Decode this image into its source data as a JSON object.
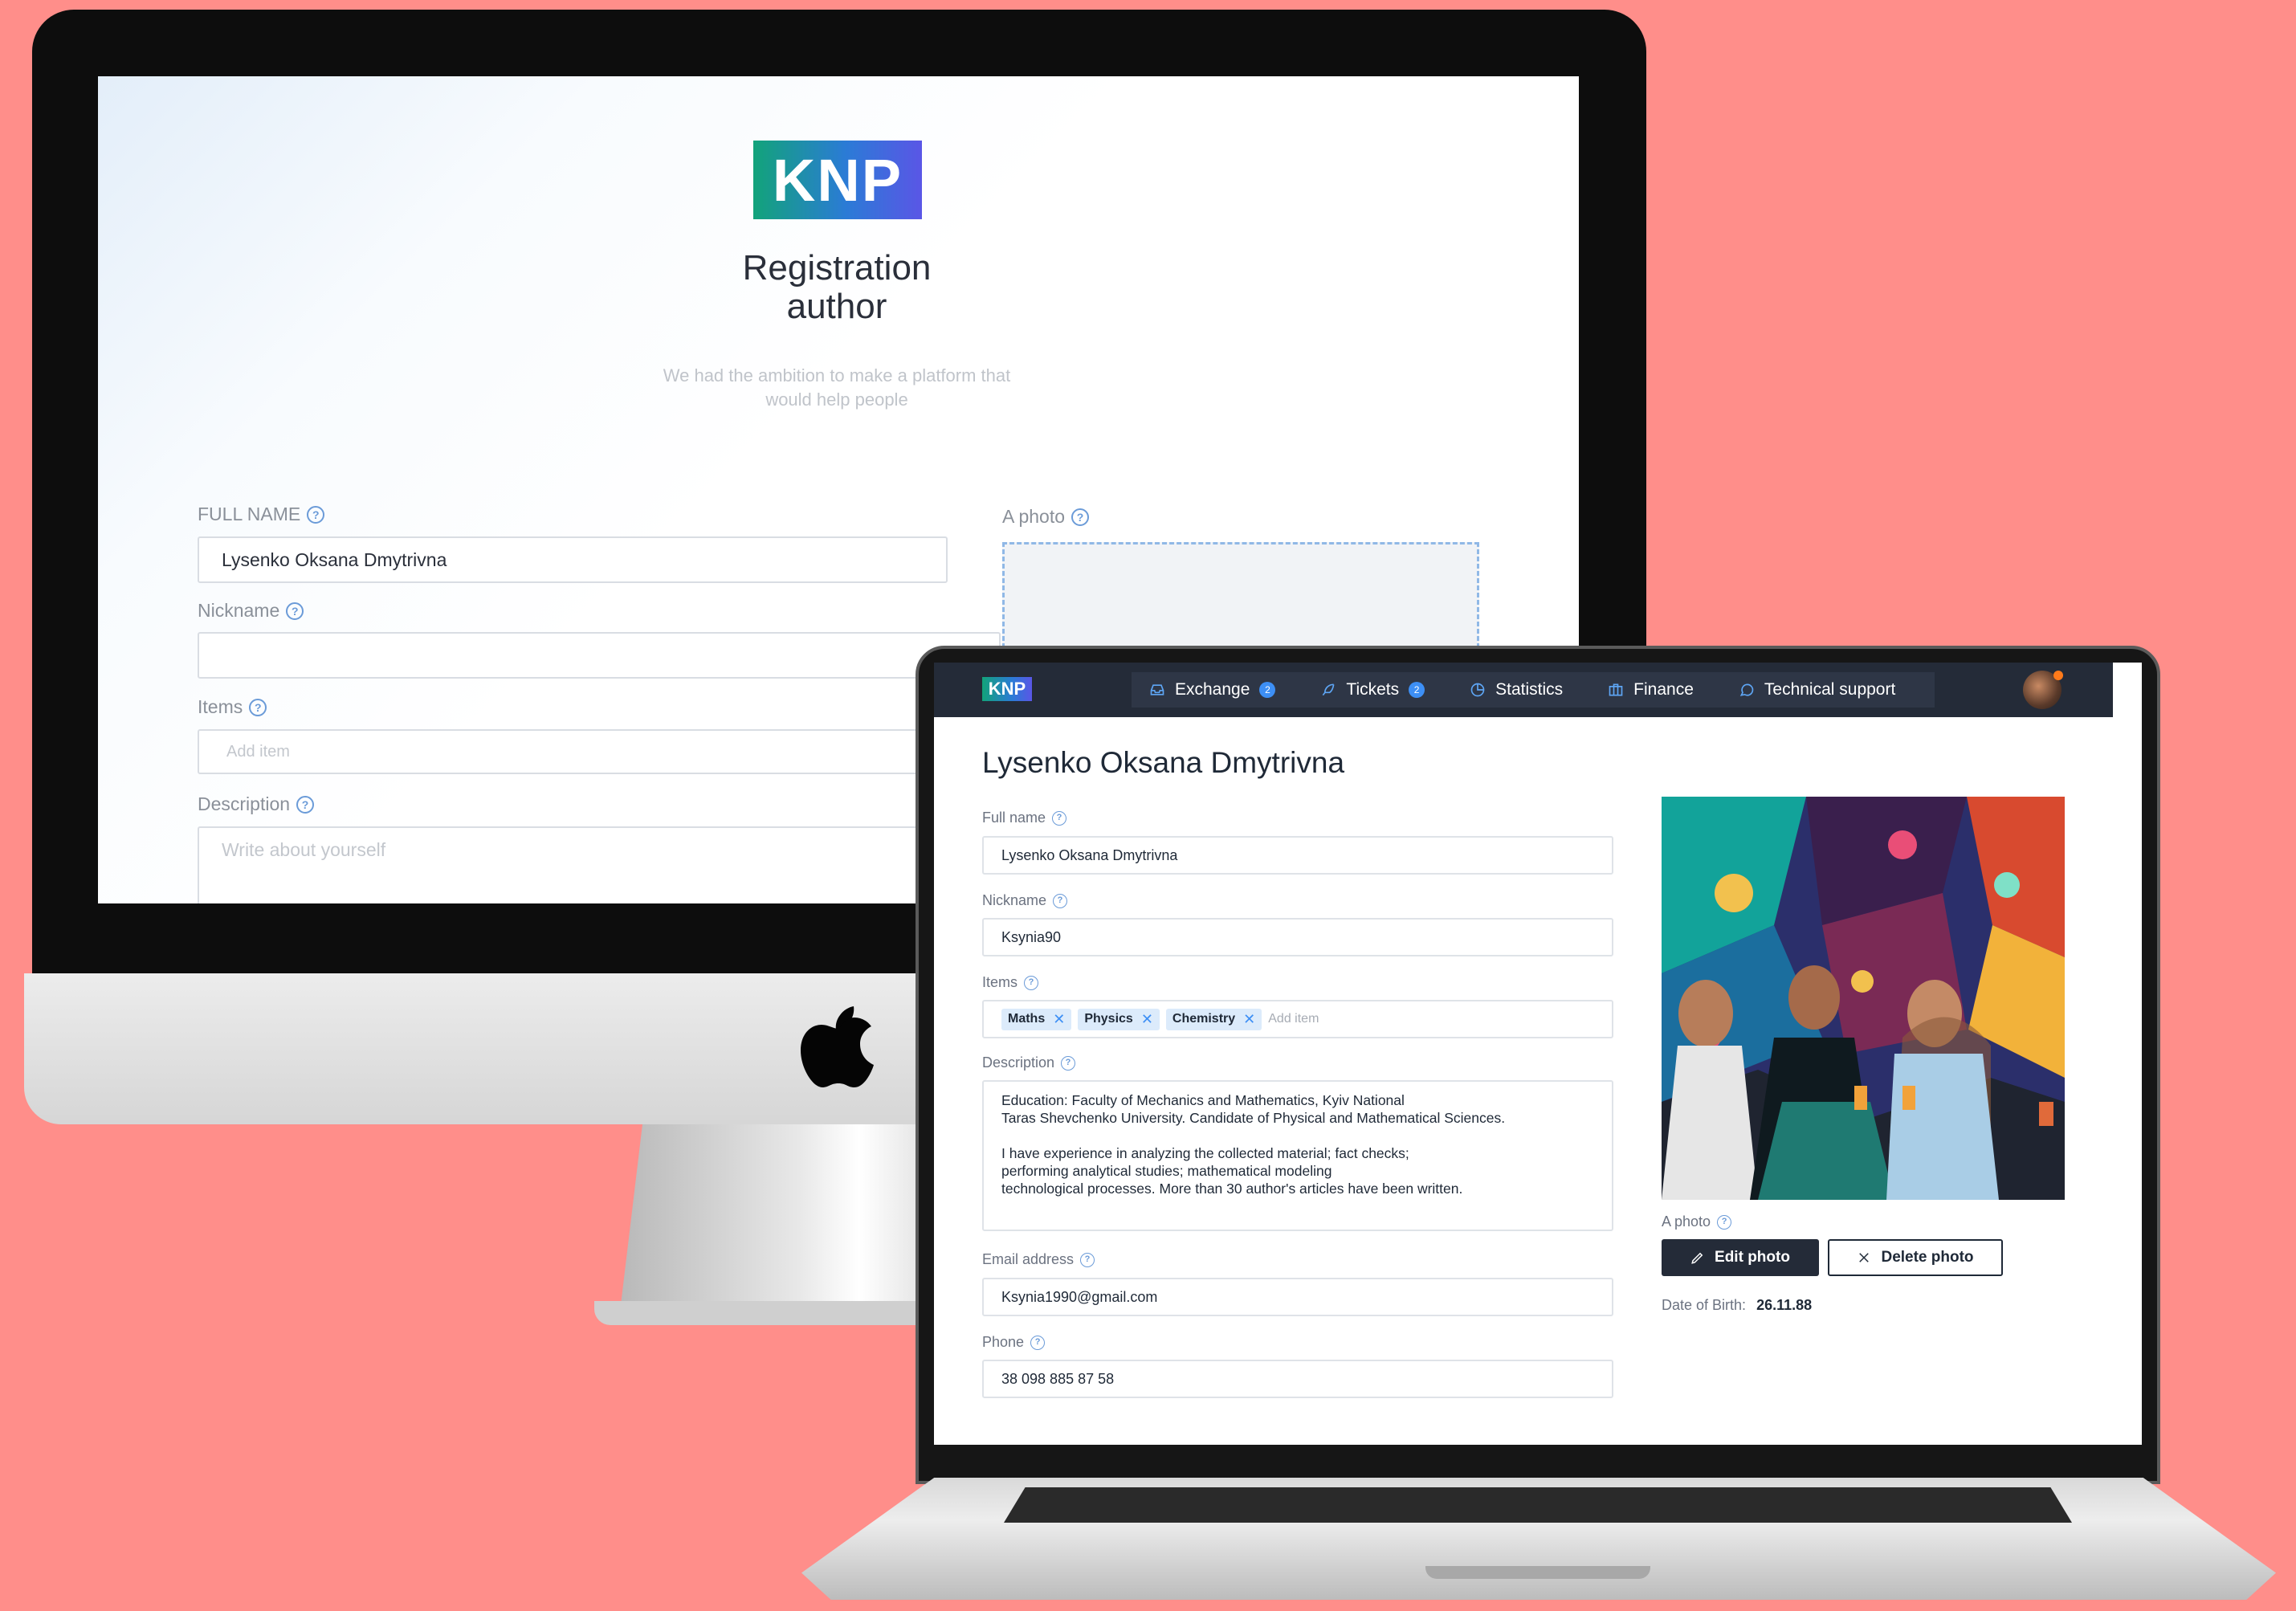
{
  "imac": {
    "logo": "KNP",
    "title_line1": "Registration",
    "title_line2": "author",
    "subtitle_line1": "We had the ambition to make a platform that",
    "subtitle_line2": "would help people",
    "full_name_label": "FULL NAME",
    "full_name_value": "Lysenko Oksana Dmytrivna",
    "nickname_label": "Nickname",
    "nickname_value": "",
    "items_label": "Items",
    "items_placeholder": "Add item",
    "description_label": "Description",
    "description_placeholder": "Write about yourself",
    "photo_label": "A photo",
    "help_icon": "?"
  },
  "laptop": {
    "nav": {
      "logo": "KNP",
      "items": [
        {
          "label": "Exchange",
          "icon": "inbox-icon",
          "badge": "2"
        },
        {
          "label": "Tickets",
          "icon": "feather-icon",
          "badge": "2"
        },
        {
          "label": "Statistics",
          "icon": "pie-chart-icon",
          "badge": ""
        },
        {
          "label": "Finance",
          "icon": "briefcase-icon",
          "badge": ""
        },
        {
          "label": "Technical support",
          "icon": "message-circle-icon",
          "badge": ""
        }
      ],
      "avatar": "user-avatar"
    },
    "page_title": "Lysenko Oksana Dmytrivna",
    "full_name_label": "Full name",
    "full_name_value": "Lysenko Oksana Dmytrivna",
    "nickname_label": "Nickname",
    "nickname_value": "Ksynia90",
    "items_label": "Items",
    "items": [
      "Maths",
      "Physics",
      "Chemistry"
    ],
    "items_placeholder": "Add item",
    "description_label": "Description",
    "description_value": "Education: Faculty of Mechanics and Mathematics, Kyiv National\nTaras Shevchenko University. Candidate of Physical and Mathematical Sciences.\n\nI have experience in analyzing the collected material; fact checks;\nperforming analytical studies; mathematical modeling\ntechnological processes. More than 30 author's articles have been written.",
    "email_label": "Email address",
    "email_value": "Ksynia1990@gmail.com",
    "phone_label": "Phone",
    "phone_value": "38 098 885 87 58",
    "photo_label": "A photo",
    "edit_photo": "Edit photo",
    "delete_photo": "Delete photo",
    "dob_label": "Date of Birth:",
    "dob_value": "26.11.88",
    "help_icon": "?"
  },
  "colors": {
    "background": "#ff8e8a",
    "nav_bg": "#242b38",
    "accent": "#3d8ff5",
    "chip_bg": "#dcebfb"
  }
}
